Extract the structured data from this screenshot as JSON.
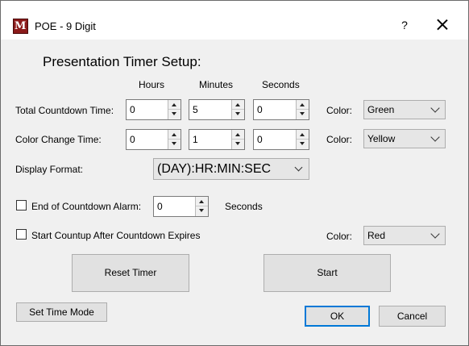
{
  "window": {
    "title": "POE - 9 Digit",
    "icon_letter": "M",
    "help_label": "?"
  },
  "heading": "Presentation Timer Setup:",
  "columns": {
    "hours": "Hours",
    "minutes": "Minutes",
    "seconds": "Seconds"
  },
  "total_countdown": {
    "label": "Total Countdown Time:",
    "hours": "0",
    "minutes": "5",
    "seconds": "0",
    "color_label": "Color:",
    "color": "Green"
  },
  "color_change": {
    "label": "Color Change Time:",
    "hours": "0",
    "minutes": "1",
    "seconds": "0",
    "color_label": "Color:",
    "color": "Yellow"
  },
  "display_format": {
    "label": "Display Format:",
    "value": "(DAY):HR:MIN:SEC"
  },
  "alarm": {
    "label": "End of Countdown Alarm:",
    "value": "0",
    "unit": "Seconds",
    "checked": false
  },
  "countup": {
    "label": "Start Countup After Countdown Expires",
    "checked": false,
    "color_label": "Color:",
    "color": "Red"
  },
  "buttons": {
    "reset": "Reset Timer",
    "start": "Start",
    "set_time_mode": "Set Time Mode",
    "ok": "OK",
    "cancel": "Cancel"
  }
}
